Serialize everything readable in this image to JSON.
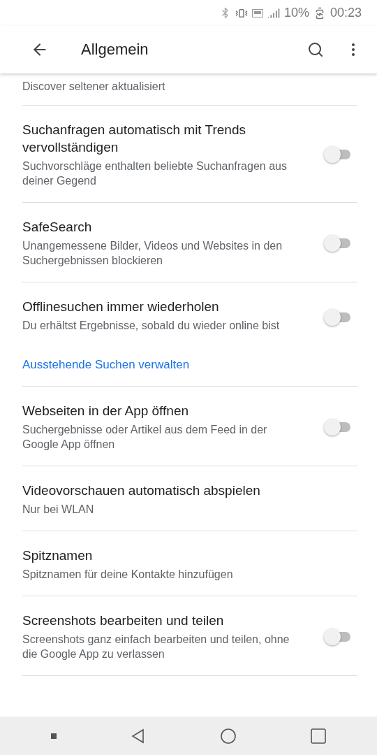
{
  "status_bar": {
    "battery": "10%",
    "time": "00:23"
  },
  "app_bar": {
    "title": "Allgemein"
  },
  "settings": [
    {
      "kind": "partial",
      "subtitle": "Discover seltener aktualisiert"
    },
    {
      "kind": "toggle",
      "title": "Suchanfragen automatisch mit Trends vervollständigen",
      "subtitle": "Suchvorschläge enthalten beliebte Suchanfragen aus deiner Gegend",
      "on": false
    },
    {
      "kind": "toggle",
      "title": "SafeSearch",
      "subtitle": "Unangemessene Bilder, Videos und Websites in den Suchergebnissen blockieren",
      "on": false
    },
    {
      "kind": "toggle",
      "title": "Offlinesuchen immer wiederholen",
      "subtitle": "Du erhältst Ergebnisse, sobald du wieder online bist",
      "on": false,
      "link": "Ausstehende Suchen verwalten"
    },
    {
      "kind": "toggle",
      "title": "Webseiten in der App öffnen",
      "subtitle": "Suchergebnisse oder Artikel aus dem Feed in der Google App öffnen",
      "on": false
    },
    {
      "kind": "text",
      "title": "Videovorschauen automatisch abspielen",
      "subtitle": "Nur bei WLAN"
    },
    {
      "kind": "text",
      "title": "Spitznamen",
      "subtitle": "Spitznamen für deine Kontakte hinzufügen"
    },
    {
      "kind": "toggle",
      "title": "Screenshots bearbeiten und teilen",
      "subtitle": "Screenshots ganz einfach bearbeiten und teilen, ohne die Google App zu verlassen",
      "on": false
    }
  ]
}
